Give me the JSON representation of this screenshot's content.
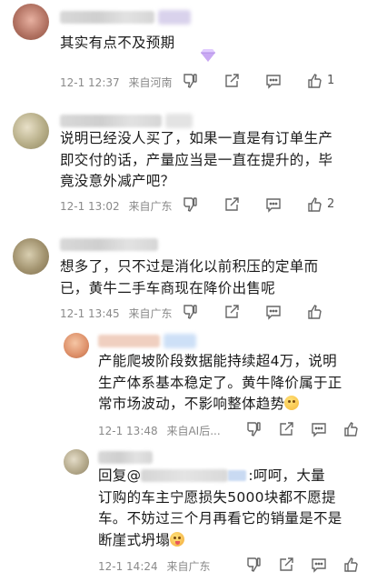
{
  "comments": [
    {
      "text_lines": [
        "其实有点不及预期"
      ],
      "time": "12-1 12:37",
      "location": "来自河南",
      "likes": "1",
      "avatar_color": "#c88a7a"
    },
    {
      "text_lines": [
        "说明已经没人买了，如果一直是有订单生产",
        "即交付的话，产量应当是一直在提升的，毕",
        "竟没意外减产吧？"
      ],
      "time": "12-1 13:02",
      "location": "来自广东",
      "likes": "2",
      "avatar_color": "#b9b49a"
    },
    {
      "text_lines": [
        "想多了，只不过是消化以前积压的定单而",
        "已，黄牛二手车商现在降价出售呢"
      ],
      "time": "12-1 13:45",
      "location": "来自广东",
      "likes": "",
      "avatar_color": "#9a8c6c"
    }
  ],
  "replies": [
    {
      "text_lines": [
        "产能爬坡阶段数据能持续超4万，说明",
        "生产体系基本稳定了。黄牛降价属于正",
        "常市场波动，不影响整体趋势"
      ],
      "time": "12-1 13:48",
      "location": "来自AI后...",
      "likes": "",
      "avatar_color": "#e2a27c"
    },
    {
      "reply_prefix": "回复@",
      "reply_suffix": ":呵呵，大量",
      "text_lines": [
        "订购的车主宁愿损失5000块都不愿提",
        "车。不妨过三个月再看它的销量是不是",
        "断崖式坍塌"
      ],
      "time": "12-1 14:24",
      "location": "来自广东",
      "likes": "",
      "avatar_color": "#b7b09a"
    }
  ],
  "icons": [
    "dislike-icon",
    "share-icon",
    "comment-icon",
    "like-icon",
    "gem-icon",
    "smile-emoji",
    "tongue-emoji"
  ]
}
